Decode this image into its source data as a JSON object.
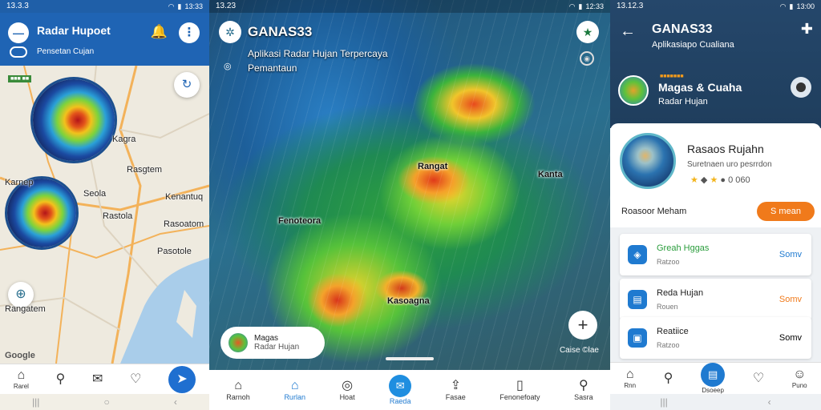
{
  "panel1": {
    "status_time": "13.3.3",
    "status_right": "13:33",
    "menu_icon": "minus-icon",
    "title": "Radar Hupoet",
    "subtitle": "Pensetan Cujan",
    "badge_text": "■■■ ■■",
    "map_labels": [
      "Kagra",
      "Rasgtem",
      "Karnep",
      "Seola",
      "Kenantuq",
      "Rastola",
      "Rasoatom",
      "Pasotole",
      "Rangatem",
      "Google"
    ],
    "nav": [
      {
        "icon": "home-icon",
        "label": "Rarel"
      },
      {
        "icon": "search-icon",
        "label": ""
      },
      {
        "icon": "chat-icon",
        "label": ""
      },
      {
        "icon": "heart-icon",
        "label": ""
      },
      {
        "icon": "navigate-icon",
        "label": ""
      }
    ],
    "accent": "#1f64b4"
  },
  "panel2": {
    "status_time": "13.23",
    "status_right": "12:33",
    "title": "GANAS33",
    "line1": "Aplikasi Radar Hujan Terpercaya",
    "line2": "Pemantaun",
    "map_labels": [
      "Rangat",
      "Kanta",
      "Fenoteora",
      "Kasoagna"
    ],
    "copyright": "Caise ©lae",
    "card_title": "Magas",
    "card_sub": "Radar Hujan",
    "nav": [
      {
        "icon": "home-icon",
        "label": "Rarnoh"
      },
      {
        "icon": "notify-icon",
        "label": "Rurlan"
      },
      {
        "icon": "compass-icon",
        "label": "Hoat"
      },
      {
        "icon": "chat-icon",
        "label": "Raeda"
      },
      {
        "icon": "share-icon",
        "label": "Fasae"
      },
      {
        "icon": "bookmark-icon",
        "label": "Fenonefoaty"
      },
      {
        "icon": "search-icon",
        "label": "Sasra"
      }
    ]
  },
  "panel3": {
    "status_time": "13.12.3",
    "status_right": "13:00",
    "title": "GANAS33",
    "subtitle": "Aplikasiapo Cualiana",
    "tag": "■■■■■■■",
    "header_name": "Magas & Cuaha",
    "header_sub": "Radar Hujan",
    "profile_name": "Rasaos Rujahn",
    "profile_desc": "Suretnaen uro pesrrdon",
    "profile_rating": "0 060",
    "profile_label": "Roasoor Meham",
    "profile_button": "S mean",
    "rows": [
      {
        "title": "Greah Hggas",
        "sub": "Ratzoo",
        "value": "Somv",
        "title_color": "#2a9d3c",
        "value_color": "#1f7ad0"
      },
      {
        "title": "Reda Hujan",
        "sub": "Rouen",
        "value": "Somv",
        "title_color": "#222222",
        "value_color": "#f07a1b"
      },
      {
        "title": "Reatiice",
        "sub": "Ratzoo",
        "value": "Somv",
        "title_color": "#222222",
        "value_color": "#222222"
      }
    ],
    "nav": [
      {
        "icon": "home-icon",
        "label": "Rnn"
      },
      {
        "icon": "search-icon",
        "label": ""
      },
      {
        "icon": "clipboard-icon",
        "label": "Dsoeep"
      },
      {
        "icon": "heart-icon",
        "label": ""
      },
      {
        "icon": "user-icon",
        "label": "Puno"
      }
    ]
  }
}
